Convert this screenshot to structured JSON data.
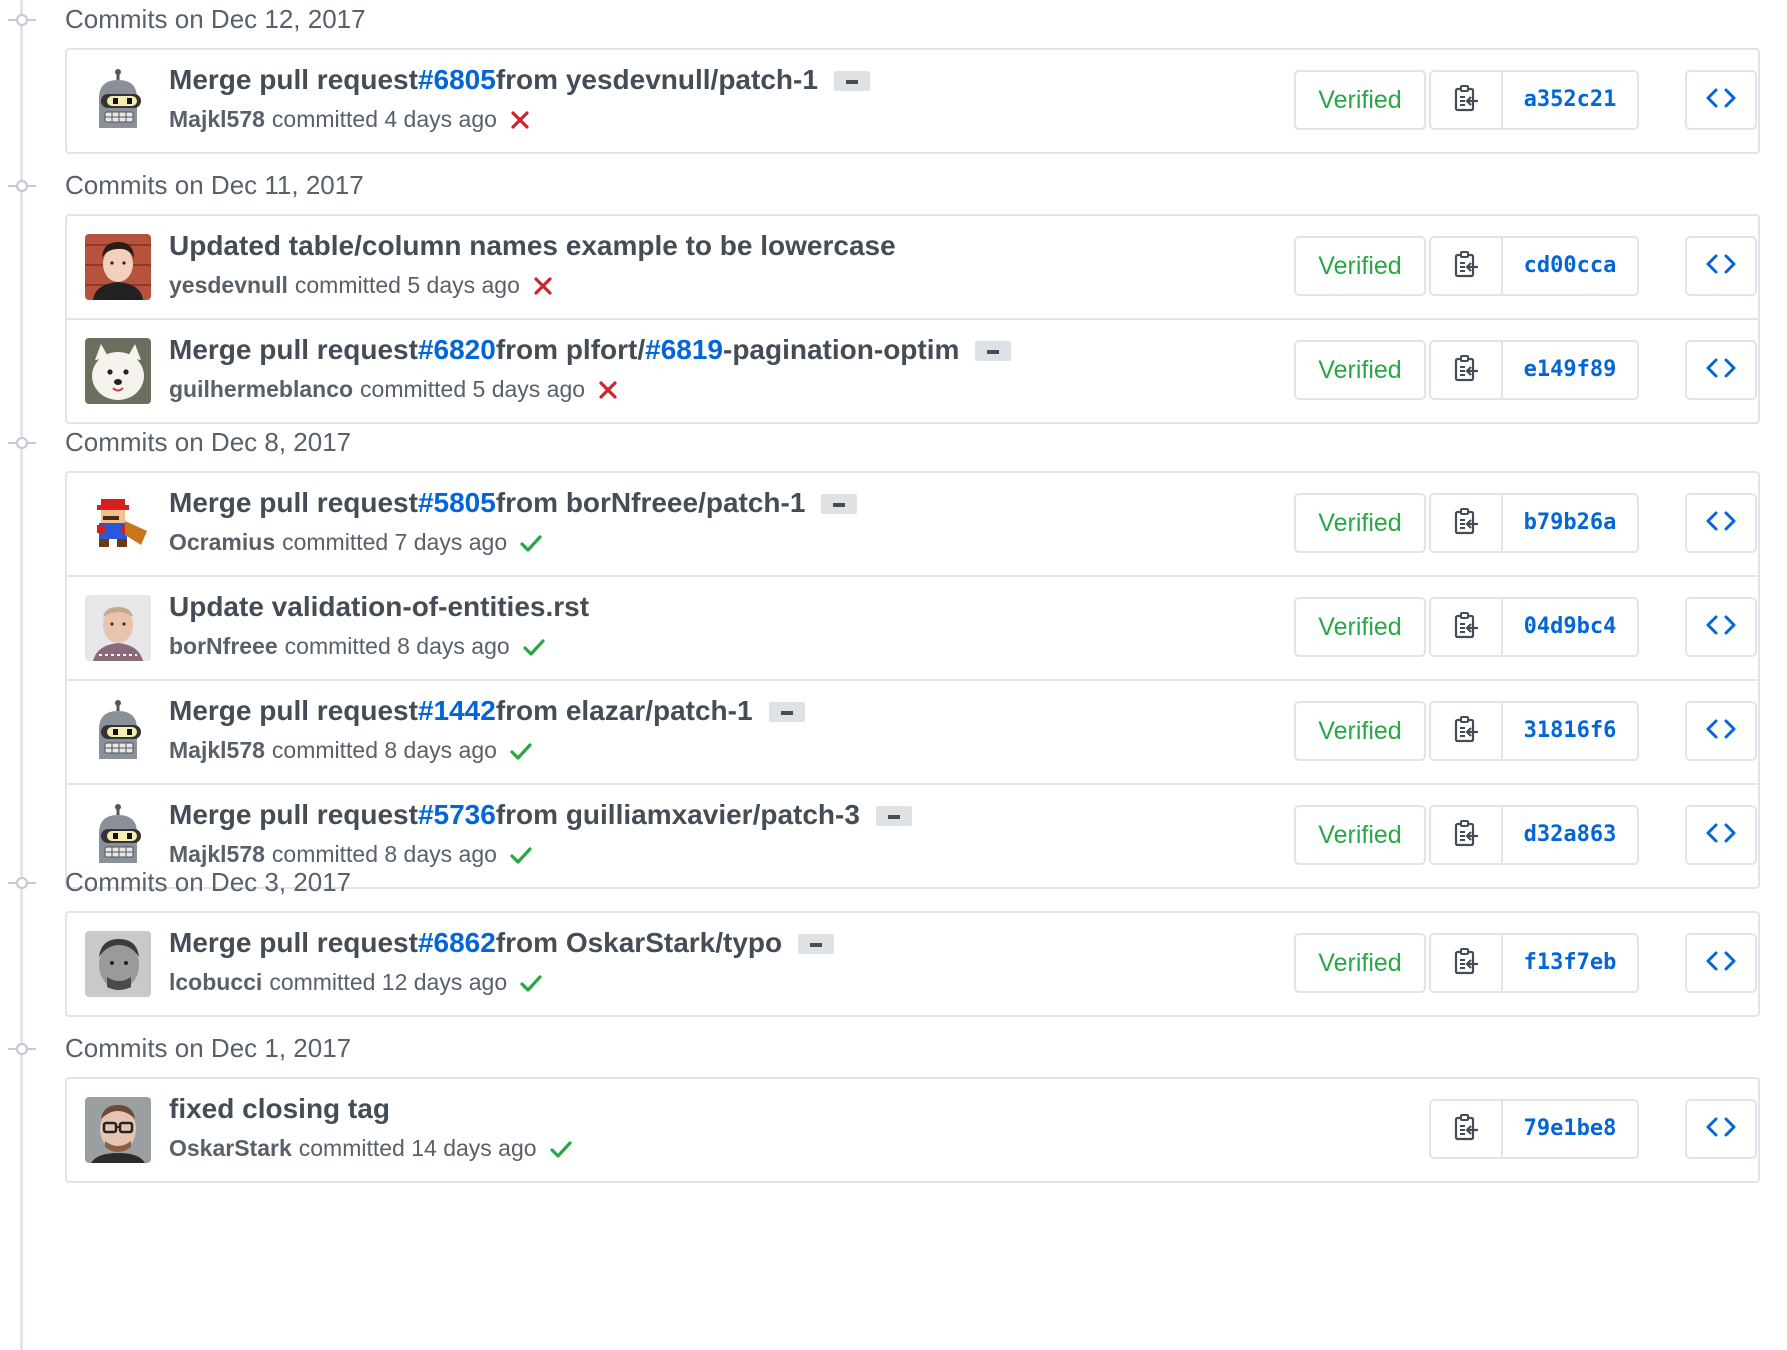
{
  "colors": {
    "link": "#0366d6",
    "verified": "#28a745",
    "failure": "#cb2431",
    "border": "#e1e4e8"
  },
  "groups": [
    {
      "title": "Commits on Dec 12, 2017",
      "commits": [
        {
          "avatar": "bender-avatar",
          "msg_pre": "Merge pull request ",
          "msg_link": "#6805",
          "msg_post": " from yesdevnull/patch-1",
          "msg_link2": "",
          "msg_post2": "",
          "has_more": true,
          "author": "Majkl578",
          "time": "committed 4 days ago",
          "status": "failure",
          "verified_label": "Verified",
          "sha": "a352c21"
        }
      ]
    },
    {
      "title": "Commits on Dec 11, 2017",
      "commits": [
        {
          "avatar": "yesdevnull-avatar",
          "msg_pre": "Updated table/column names example to be lowercase",
          "msg_link": "",
          "msg_post": "",
          "msg_link2": "",
          "msg_post2": "",
          "has_more": false,
          "author": "yesdevnull",
          "time": "committed 5 days ago",
          "status": "failure",
          "verified_label": "Verified",
          "sha": "cd00cca"
        },
        {
          "avatar": "dog-avatar",
          "msg_pre": "Merge pull request ",
          "msg_link": "#6820",
          "msg_post": " from plfort/",
          "msg_link2": "#6819",
          "msg_post2": "-pagination-optim",
          "has_more": true,
          "author": "guilhermeblanco",
          "time": "committed 5 days ago",
          "status": "failure",
          "verified_label": "Verified",
          "sha": "e149f89"
        }
      ]
    },
    {
      "title": "Commits on Dec 8, 2017",
      "commits": [
        {
          "avatar": "mario-avatar",
          "msg_pre": "Merge pull request ",
          "msg_link": "#5805",
          "msg_post": " from borNfreee/patch-1",
          "msg_link2": "",
          "msg_post2": "",
          "has_more": true,
          "author": "Ocramius",
          "time": "committed 7 days ago",
          "status": "success",
          "verified_label": "Verified",
          "sha": "b79b26a"
        },
        {
          "avatar": "bornfreee-avatar",
          "msg_pre": "Update validation-of-entities.rst",
          "msg_link": "",
          "msg_post": "",
          "msg_link2": "",
          "msg_post2": "",
          "has_more": false,
          "author": "borNfreee",
          "time": "committed 8 days ago",
          "status": "success",
          "verified_label": "Verified",
          "sha": "04d9bc4"
        },
        {
          "avatar": "bender-avatar",
          "msg_pre": "Merge pull request ",
          "msg_link": "#1442",
          "msg_post": " from elazar/patch-1",
          "msg_link2": "",
          "msg_post2": "",
          "has_more": true,
          "author": "Majkl578",
          "time": "committed 8 days ago",
          "status": "success",
          "verified_label": "Verified",
          "sha": "31816f6"
        },
        {
          "avatar": "bender-avatar",
          "msg_pre": "Merge pull request ",
          "msg_link": "#5736",
          "msg_post": " from guilliamxavier/patch-3",
          "msg_link2": "",
          "msg_post2": "",
          "has_more": true,
          "author": "Majkl578",
          "time": "committed 8 days ago",
          "status": "success",
          "verified_label": "Verified",
          "sha": "d32a863"
        }
      ]
    },
    {
      "title": "Commits on Dec 3, 2017",
      "commits": [
        {
          "avatar": "lcobucci-avatar",
          "msg_pre": "Merge pull request ",
          "msg_link": "#6862",
          "msg_post": " from OskarStark/typo",
          "msg_link2": "",
          "msg_post2": "",
          "has_more": true,
          "author": "lcobucci",
          "time": "committed 12 days ago",
          "status": "success",
          "verified_label": "Verified",
          "sha": "f13f7eb"
        }
      ]
    },
    {
      "title": "Commits on Dec 1, 2017",
      "commits": [
        {
          "avatar": "oskarstark-avatar",
          "msg_pre": "fixed closing tag",
          "msg_link": "",
          "msg_post": "",
          "msg_link2": "",
          "msg_post2": "",
          "has_more": false,
          "author": "OskarStark",
          "time": "committed 14 days ago",
          "status": "success",
          "verified_label": "",
          "sha": "79e1be8"
        }
      ]
    }
  ]
}
